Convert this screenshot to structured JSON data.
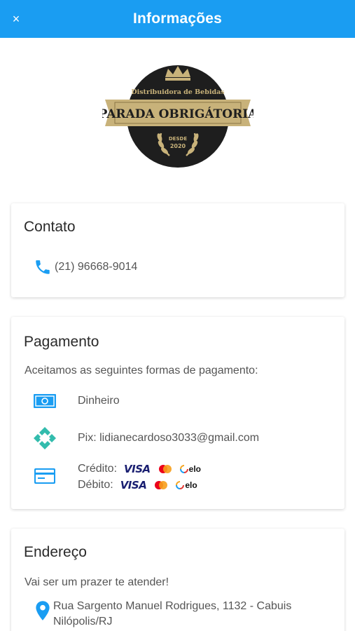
{
  "header": {
    "title": "Informações",
    "close_glyph": "×"
  },
  "logo": {
    "line1": "Distribuidora de Bebidas",
    "line2": "PARADA OBRIGÁTORIA",
    "line3": "DESDE",
    "line4": "2020"
  },
  "contato": {
    "title": "Contato",
    "phone": "(21) 96668-9014",
    "icon": "phone-icon"
  },
  "pagamento": {
    "title": "Pagamento",
    "intro": "Aceitamos as seguintes formas de pagamento:",
    "dinheiro": "Dinheiro",
    "pix": "Pix: lidianecardoso3033@gmail.com",
    "credito_label": "Crédito:",
    "debito_label": "Débito:",
    "brand_visa": "VISA",
    "brand_elo": "elo"
  },
  "endereco": {
    "title": "Endereço",
    "sub": "Vai ser um prazer te atender!",
    "line1": "Rua Sargento Manuel Rodrigues, 1132 - Cabuis",
    "line2": "Nilópolis/RJ"
  },
  "colors": {
    "header_bg": "#1a9df2",
    "accent_blue": "#1a9df2",
    "pix_green": "#32bcad",
    "logo_gold": "#c8b27a",
    "logo_dark": "#1e1e1e"
  }
}
